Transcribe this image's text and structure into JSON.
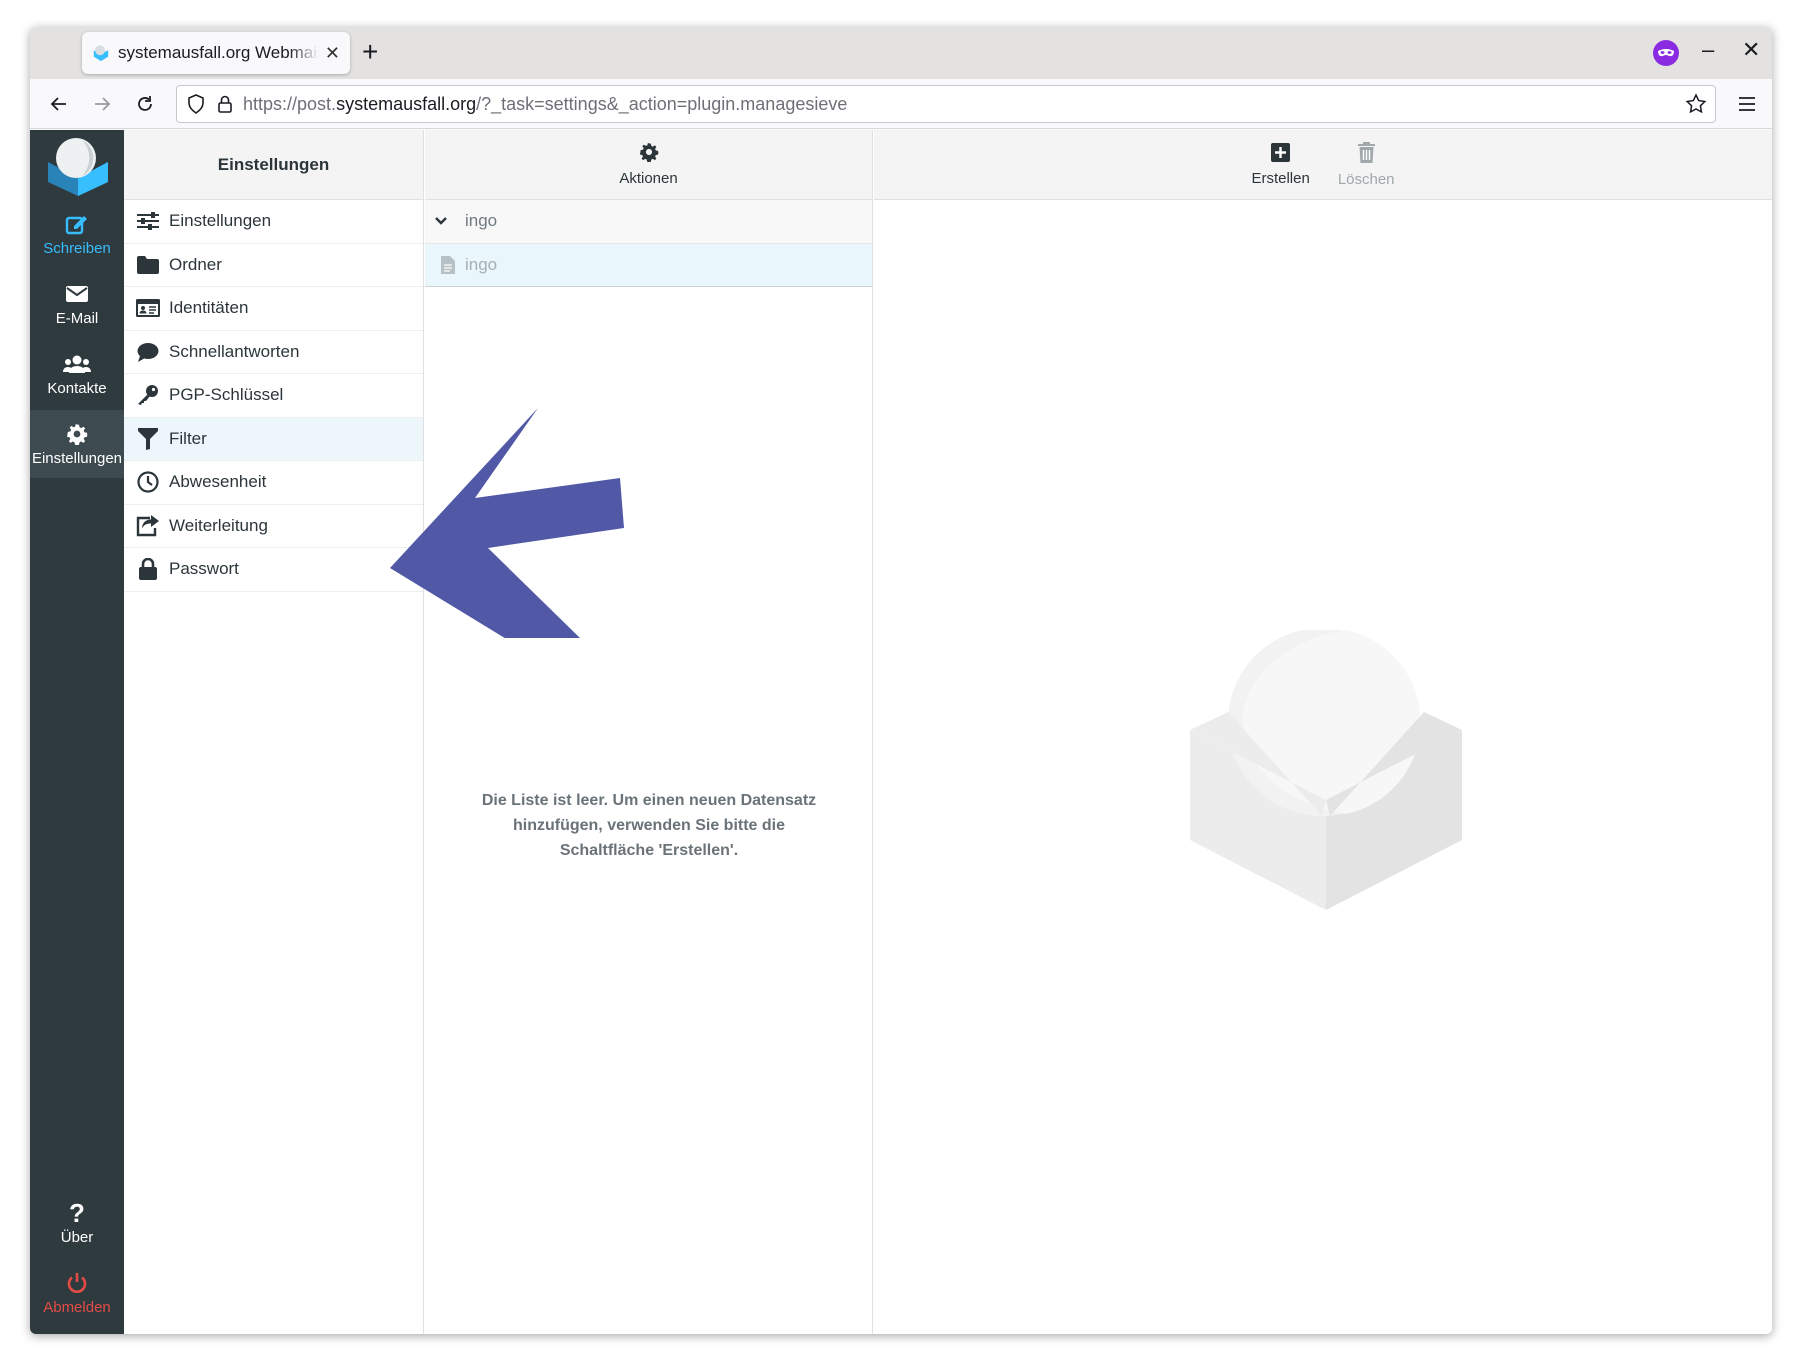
{
  "browser": {
    "tab_title": "systemausfall.org Webmail",
    "url_prefix": "https://post.",
    "url_host": "systemausfall.org",
    "url_path": "/?_task=settings&_action=plugin.managesieve"
  },
  "rail": {
    "compose": "Schreiben",
    "mail": "E-Mail",
    "contacts": "Kontakte",
    "settings": "Einstellungen",
    "about": "Über",
    "logout": "Abmelden"
  },
  "settings_panel": {
    "header": "Einstellungen",
    "items": [
      {
        "label": "Einstellungen",
        "icon": "sliders-icon"
      },
      {
        "label": "Ordner",
        "icon": "folder-icon"
      },
      {
        "label": "Identitäten",
        "icon": "id-card-icon"
      },
      {
        "label": "Schnellantworten",
        "icon": "comment-icon"
      },
      {
        "label": "PGP-Schlüssel",
        "icon": "key-icon"
      },
      {
        "label": "Filter",
        "icon": "filter-icon",
        "selected": true
      },
      {
        "label": "Abwesenheit",
        "icon": "clock-icon"
      },
      {
        "label": "Weiterleitung",
        "icon": "forward-icon"
      },
      {
        "label": "Passwort",
        "icon": "lock-icon"
      }
    ]
  },
  "filtersets": {
    "header": "Aktionen",
    "group_name": "ingo",
    "filter_name": "ingo",
    "empty_message": "Die Liste ist leer. Um einen neuen Datensatz hinzufügen, verwenden Sie bitte die Schaltfläche 'Erstellen'."
  },
  "main": {
    "create_label": "Erstellen",
    "delete_label": "Löschen"
  },
  "colors": {
    "rail_bg": "#2f3a3f",
    "accent": "#37beff",
    "logout": "#e34b47",
    "arrow": "#5159a7"
  }
}
